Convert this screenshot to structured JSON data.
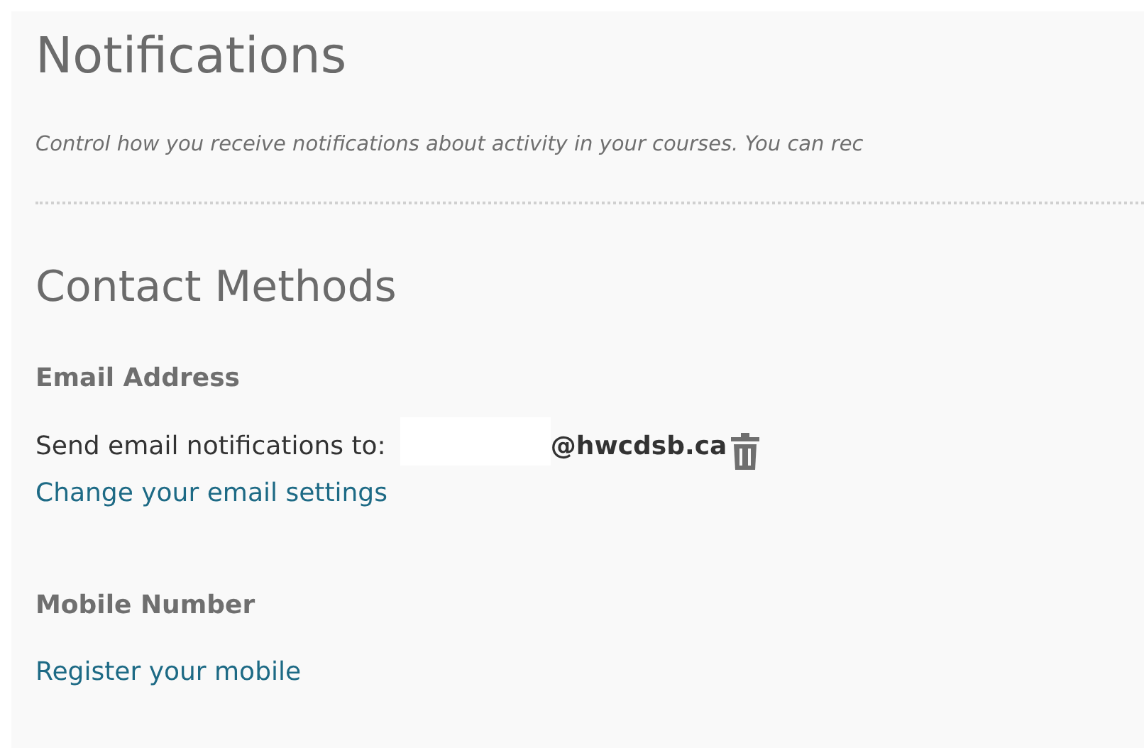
{
  "page": {
    "title": "Notifications",
    "description": "Control how you receive notifications about activity in your courses. You can rec"
  },
  "contact_methods": {
    "heading": "Contact Methods",
    "email": {
      "label": "Email Address",
      "prefix": "Send email notifications to:",
      "address": "@hwcdsb.ca",
      "link": "Change your email settings"
    },
    "mobile": {
      "label": "Mobile Number",
      "link": "Register your mobile"
    }
  }
}
